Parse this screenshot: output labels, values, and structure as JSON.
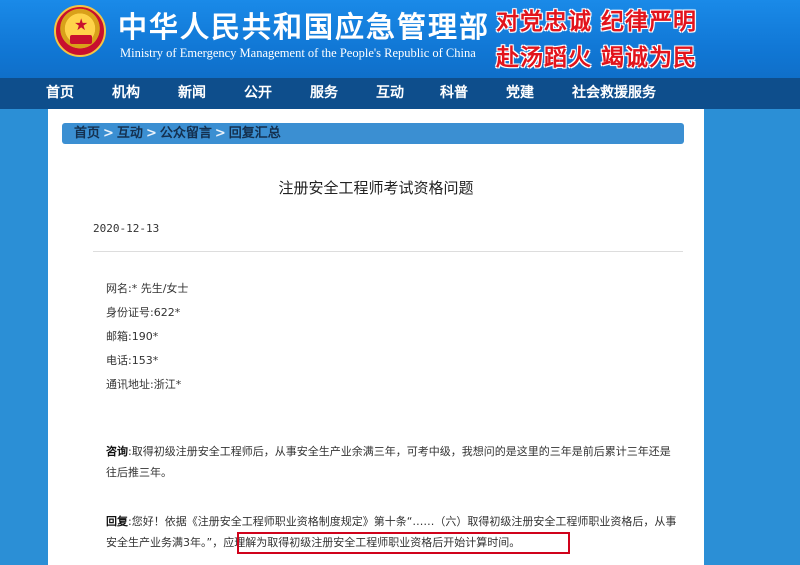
{
  "header": {
    "title": "中华人民共和国应急管理部",
    "subtitle": "Ministry of Emergency Management of the People's Republic of China",
    "slogan_line1": "对党忠诚 纪律严明",
    "slogan_line2": "赴汤蹈火 竭诚为民"
  },
  "nav": {
    "items": [
      "首页",
      "机构",
      "新闻",
      "公开",
      "服务",
      "互动",
      "科普",
      "党建",
      "社会救援服务"
    ]
  },
  "breadcrumb": {
    "items": [
      "首页",
      "互动",
      "公众留言",
      "回复汇总"
    ],
    "separator": ">"
  },
  "article": {
    "title": "注册安全工程师考试资格问题",
    "date": "2020-12-13",
    "info": [
      "网名:* 先生/女士",
      "身份证号:622*",
      "邮箱:190*",
      "电话:153*",
      "通讯地址:浙江*"
    ],
    "question_label": "咨询",
    "question_text": ":取得初级注册安全工程师后，从事安全生产业余满三年，可考中级，我想问的是这里的三年是前后累计三年还是往后推三年。",
    "reply_label": "回复",
    "reply_text": ":您好！依据《注册安全工程师职业资格制度规定》第十条“……（六）取得初级注册安全工程师职业资格后，从事安全生产业务满3年。”，",
    "reply_highlight": "应理解为取得初级注册安全工程师职业资格后开始计算时间。"
  },
  "colors": {
    "header_blue": "#1178d6",
    "nav_dark_blue": "#0e4e8c",
    "breadcrumb_blue": "#3b8fd2",
    "highlight_red": "#d0021b",
    "slogan_red": "#e2141c"
  }
}
